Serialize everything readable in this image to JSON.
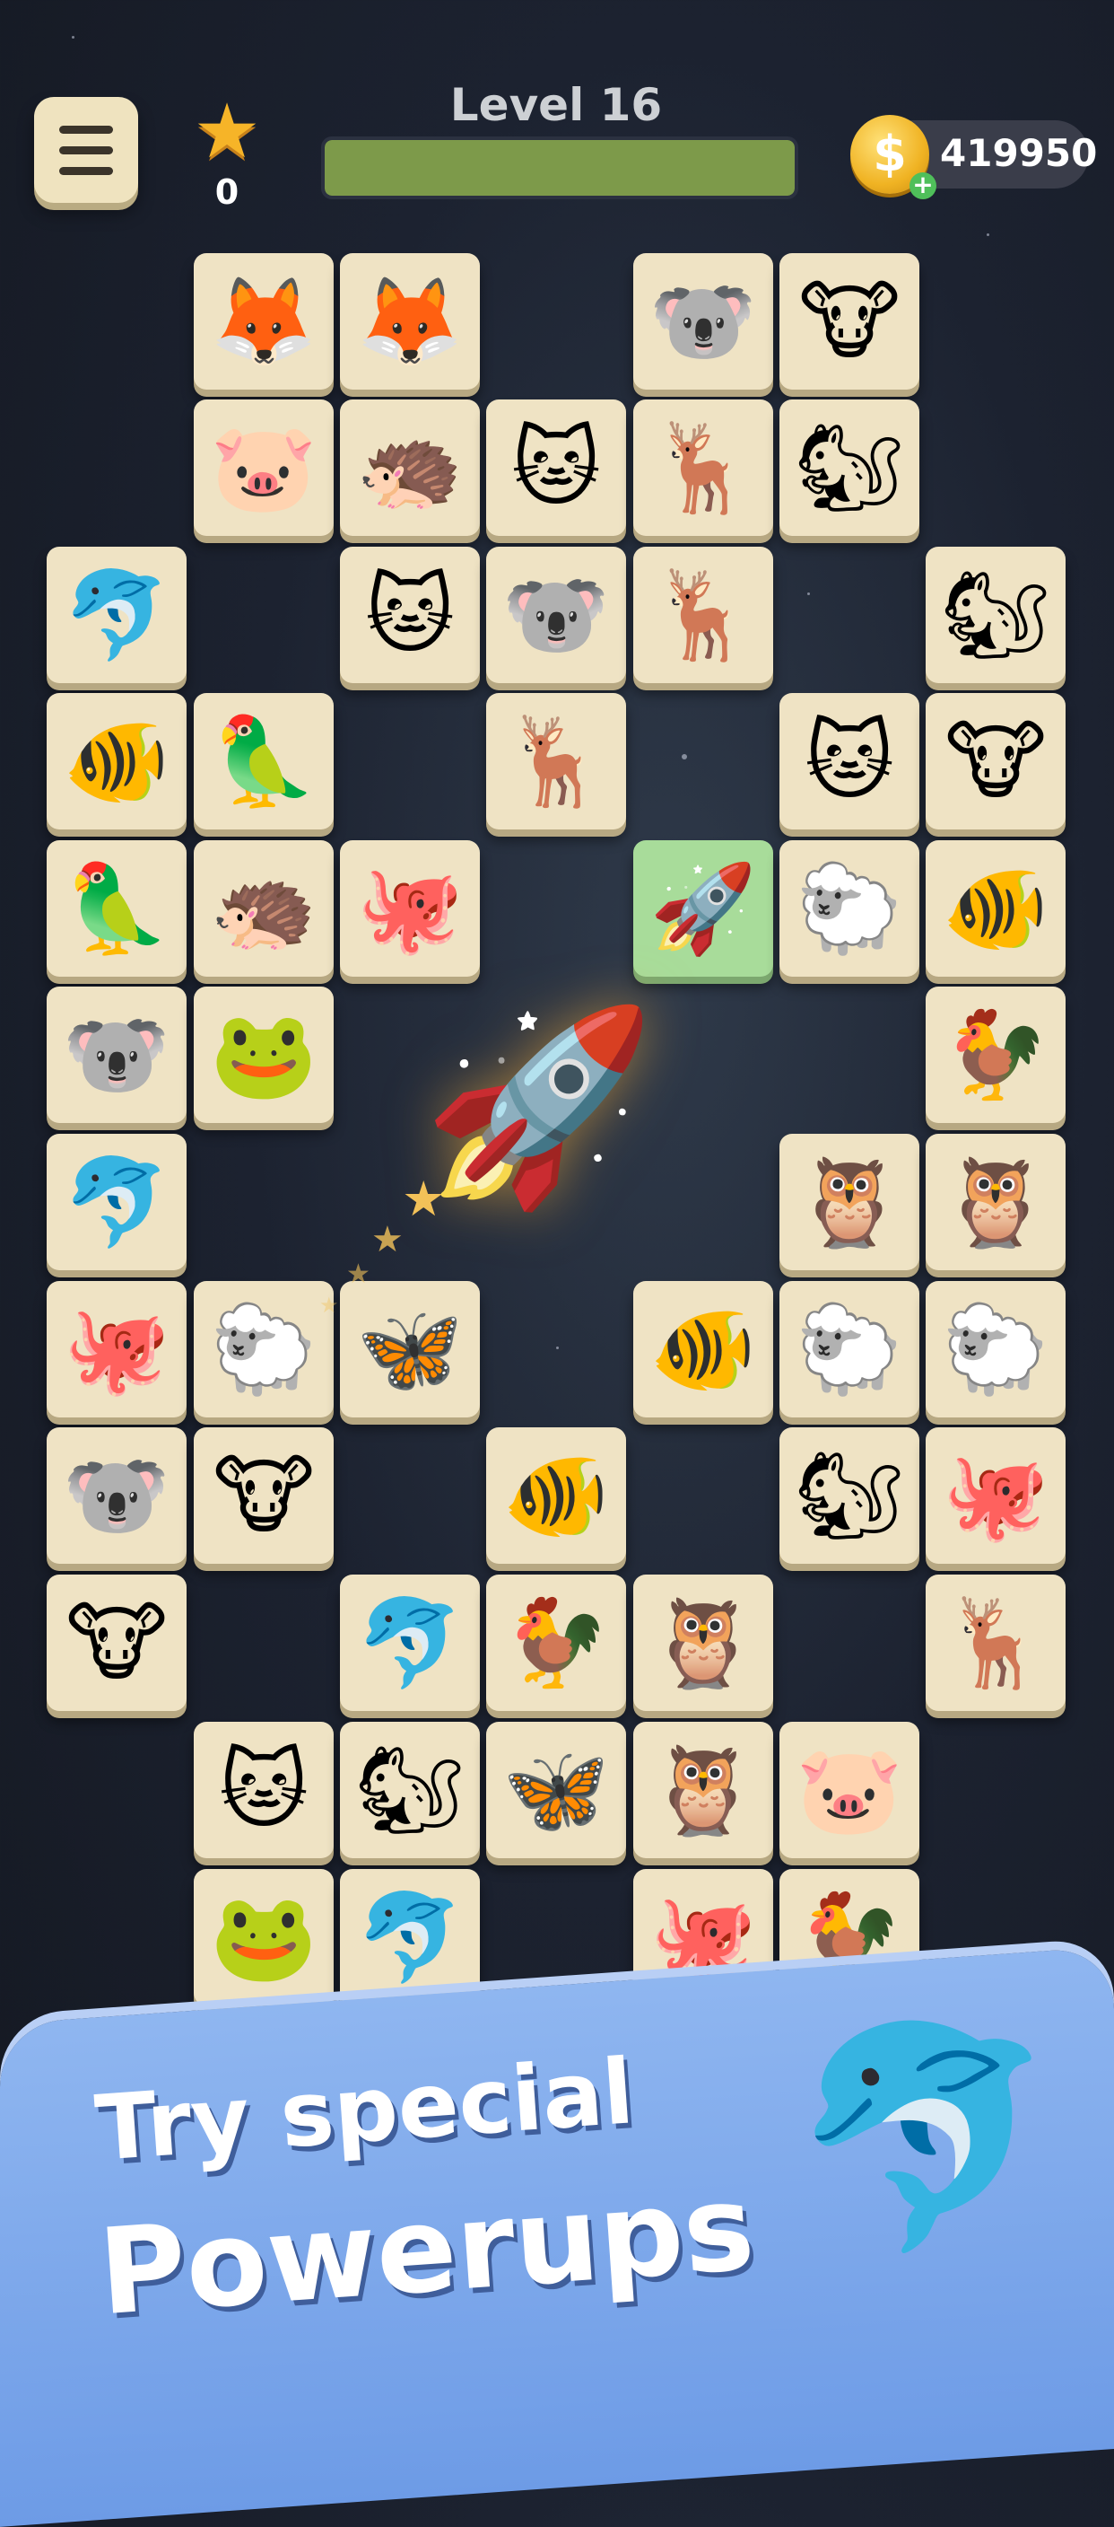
{
  "header": {
    "menu_icon": "hamburger-menu-icon",
    "stars_count": "0",
    "level_title": "Level 16",
    "level_progress": 1.0,
    "coins": "419950",
    "coin_symbol": "$",
    "coin_plus": "+"
  },
  "board": {
    "tiles": [
      {
        "animal": "fox",
        "glyph": "🦊"
      },
      {
        "animal": "fox",
        "glyph": "🦊"
      },
      {
        "animal": "koala",
        "glyph": "🐨"
      },
      {
        "animal": "cow",
        "glyph": "🐮"
      },
      {
        "animal": "pig",
        "glyph": "🐷"
      },
      {
        "animal": "hedgehog",
        "glyph": "🦔"
      },
      {
        "animal": "cat",
        "glyph": "🐱"
      },
      {
        "animal": "deer",
        "glyph": "🦌"
      },
      {
        "animal": "squirrel",
        "glyph": "🐿"
      },
      {
        "animal": "dolphin",
        "glyph": "🐬"
      },
      {
        "animal": "cat",
        "glyph": "🐱"
      },
      {
        "animal": "koala",
        "glyph": "🐨"
      },
      {
        "animal": "deer",
        "glyph": "🦌"
      },
      {
        "animal": "squirrel",
        "glyph": "🐿"
      },
      {
        "animal": "fish",
        "glyph": "🐠"
      },
      {
        "animal": "parrot",
        "glyph": "🦜"
      },
      {
        "animal": "deer",
        "glyph": "🦌"
      },
      {
        "animal": "cat",
        "glyph": "🐱"
      },
      {
        "animal": "cow",
        "glyph": "🐮"
      },
      {
        "animal": "parrot",
        "glyph": "🦜"
      },
      {
        "animal": "hedgehog",
        "glyph": "🦔"
      },
      {
        "animal": "octopus",
        "glyph": "🐙"
      },
      {
        "animal": "rocket",
        "glyph": "🚀"
      },
      {
        "animal": "sheep",
        "glyph": "🐑"
      },
      {
        "animal": "fish",
        "glyph": "🐠"
      },
      {
        "animal": "koala",
        "glyph": "🐨"
      },
      {
        "animal": "frog",
        "glyph": "🐸"
      },
      {
        "animal": "rooster",
        "glyph": "🐓"
      },
      {
        "animal": "dolphin",
        "glyph": "🐬"
      },
      {
        "animal": "owl",
        "glyph": "🦉"
      },
      {
        "animal": "owl",
        "glyph": "🦉"
      },
      {
        "animal": "octopus",
        "glyph": "🐙"
      },
      {
        "animal": "sheep",
        "glyph": "🐑"
      },
      {
        "animal": "butterfly",
        "glyph": "🦋"
      },
      {
        "animal": "fish",
        "glyph": "🐠"
      },
      {
        "animal": "sheep",
        "glyph": "🐑"
      },
      {
        "animal": "sheep",
        "glyph": "🐑"
      },
      {
        "animal": "koala",
        "glyph": "🐨"
      },
      {
        "animal": "cow",
        "glyph": "🐮"
      },
      {
        "animal": "fish",
        "glyph": "🐠"
      },
      {
        "animal": "squirrel",
        "glyph": "🐿"
      },
      {
        "animal": "octopus",
        "glyph": "🐙"
      },
      {
        "animal": "cow",
        "glyph": "🐮"
      },
      {
        "animal": "dolphin",
        "glyph": "🐬"
      },
      {
        "animal": "rooster",
        "glyph": "🐓"
      },
      {
        "animal": "owl",
        "glyph": "🦉"
      },
      {
        "animal": "deer",
        "glyph": "🦌"
      },
      {
        "animal": "cat",
        "glyph": "🐱"
      },
      {
        "animal": "squirrel",
        "glyph": "🐿"
      },
      {
        "animal": "butterfly",
        "glyph": "🦋"
      },
      {
        "animal": "owl",
        "glyph": "🦉"
      },
      {
        "animal": "pig",
        "glyph": "🐷"
      },
      {
        "animal": "frog",
        "glyph": "🐸"
      },
      {
        "animal": "dolphin",
        "glyph": "🐬"
      },
      {
        "animal": "octopus",
        "glyph": "🐙"
      },
      {
        "animal": "rooster",
        "glyph": "🐓"
      }
    ],
    "flying_powerup_glyph": "🚀",
    "trail_glyph": "★"
  },
  "promo": {
    "line1": "Try special",
    "line2": "Powerups",
    "mascot_glyph": "🐬"
  },
  "colors": {
    "tile": "#efe3c4",
    "selected_tile": "#a8dc9a",
    "progress": "#7d9a4a",
    "banner": "#7aa6ec"
  }
}
